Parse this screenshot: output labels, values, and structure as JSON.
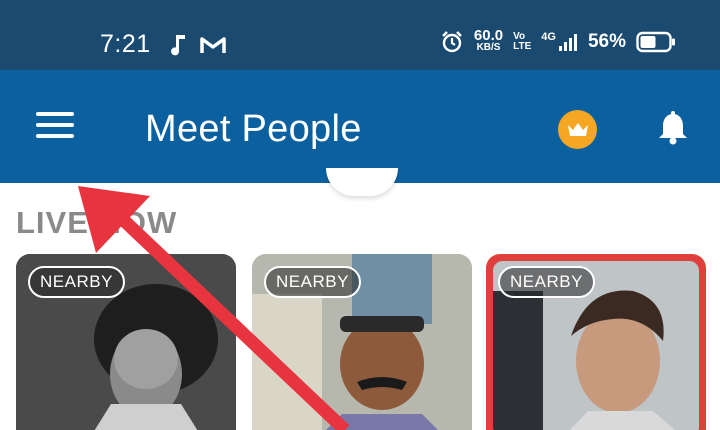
{
  "status_bar": {
    "time": "7:21",
    "icons": [
      "music-note-icon",
      "gmail-icon",
      "alarm-icon",
      "signal-icon",
      "battery-icon"
    ],
    "net_speed_value": "60.0",
    "net_speed_unit": "KB/S",
    "volte_top": "Vo",
    "volte_bottom": "LTE",
    "network": "4G",
    "battery": "56%"
  },
  "app_bar": {
    "title": "Meet People",
    "menu_icon": "hamburger-menu-icon",
    "crown_icon": "crown-icon",
    "bell_icon": "bell-icon",
    "colors": {
      "bar": "#0b60a0",
      "crown": "#f5a623"
    }
  },
  "section": {
    "title": "LIVE NOW"
  },
  "cards": [
    {
      "badge": "NEARBY",
      "highlighted": false
    },
    {
      "badge": "NEARBY",
      "highlighted": false
    },
    {
      "badge": "NEARBY",
      "highlighted": true
    }
  ],
  "annotation": {
    "type": "arrow",
    "color": "#e8343f"
  }
}
